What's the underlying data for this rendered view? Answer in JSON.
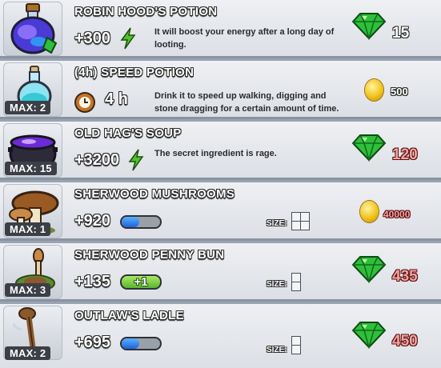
{
  "items": [
    {
      "name": "ROBIN HOOD'S POTION",
      "max": "",
      "stat": "+300",
      "description": "It will boost your energy after a long day of looting.",
      "price": "15",
      "currency": "gem",
      "affordable": true
    },
    {
      "name": "(4h) SPEED POTION",
      "max": "MAX: 2",
      "stat": "4 h",
      "description": "Drink it to speed up walking, digging and stone dragging for a certain amount of time.",
      "price": "500",
      "currency": "coin",
      "affordable": true
    },
    {
      "name": "OLD HAG'S SOUP",
      "max": "MAX: 15",
      "stat": "+3200",
      "description": "The secret ingredient is rage.",
      "price": "120",
      "currency": "gem",
      "affordable": false
    },
    {
      "name": "SHERWOOD MUSHROOMS",
      "max": "MAX: 1",
      "stat": "+920",
      "size_label": "SIZE:",
      "price": "40000",
      "currency": "coin",
      "affordable": false,
      "meter_level": 0.45
    },
    {
      "name": "SHERWOOD PENNY BUN",
      "max": "MAX: 3",
      "stat": "+135",
      "badge": "+1",
      "size_label": "SIZE:",
      "price": "435",
      "currency": "gem",
      "affordable": false
    },
    {
      "name": "OUTLAW'S LADLE",
      "max": "MAX: 2",
      "stat": "+695",
      "size_label": "SIZE:",
      "price": "450",
      "currency": "gem",
      "affordable": false,
      "meter_level": 0.45
    }
  ],
  "colors": {
    "gem": "#2fbf3a",
    "coin": "#f2c21b",
    "unaffordable_price": "#f4a3a3",
    "meter_fill": "#1f63d8",
    "energy_bolt": "#4fc12a"
  },
  "icons": {
    "energy": "lightning-bolt-icon",
    "time": "clock-icon",
    "premium_currency": "emerald-gem-icon",
    "soft_currency": "gold-coin-icon",
    "size": "size-grid-icon"
  }
}
